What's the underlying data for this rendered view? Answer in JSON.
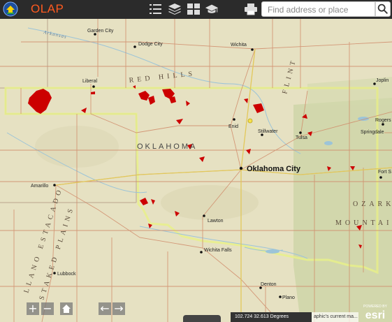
{
  "header": {
    "app_title": "OLAP",
    "search_placeholder": "Find address or place",
    "tools": [
      "legend-icon",
      "layers-icon",
      "basemap-icon",
      "education-icon",
      "print-icon"
    ]
  },
  "map": {
    "state_label": "OKLAHOMA",
    "cities": [
      {
        "name": "Garden City"
      },
      {
        "name": "Dodge City"
      },
      {
        "name": "Wichita"
      },
      {
        "name": "Liberal"
      },
      {
        "name": "Joplin"
      },
      {
        "name": "Enid"
      },
      {
        "name": "Stillwater"
      },
      {
        "name": "Tulsa"
      },
      {
        "name": "Rogers"
      },
      {
        "name": "Springdale"
      },
      {
        "name": "Oklahoma City"
      },
      {
        "name": "Fort S"
      },
      {
        "name": "Amarillo"
      },
      {
        "name": "Lawton"
      },
      {
        "name": "Wichita Falls"
      },
      {
        "name": "Lubbock"
      },
      {
        "name": "Denton"
      },
      {
        "name": "Plano"
      }
    ],
    "terrain_labels": [
      "Arkansas",
      "RED HILLS",
      "FLINT",
      "LLANO ESTACADO",
      "STAKED PLAINS",
      "OZARK",
      "MOUNTAINS"
    ],
    "feature_color": "#cc0000",
    "land_color": "#e9e4c8"
  },
  "controls": {
    "zoom_in": "+",
    "zoom_out": "−",
    "home": "home-icon",
    "back": "←",
    "forward": "→"
  },
  "footer": {
    "coordinates": "102.724 32.613 Degrees",
    "attribution": "aphic's current ma...",
    "logo_text": "esri",
    "logo_powered": "POWERED BY"
  }
}
